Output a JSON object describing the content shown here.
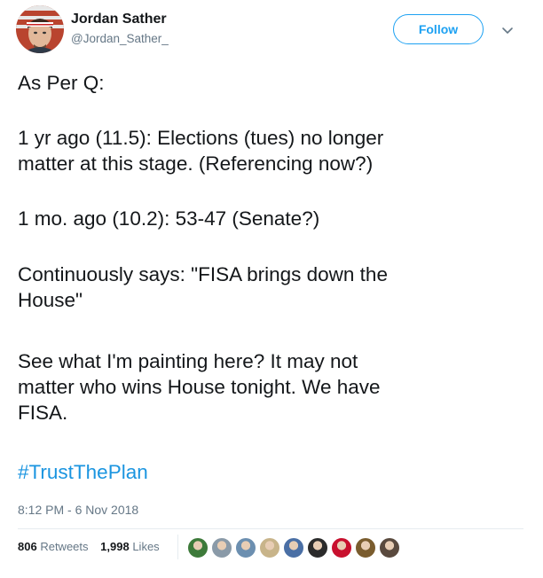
{
  "author": {
    "display_name": "Jordan Sather",
    "handle": "@Jordan_Sather_"
  },
  "follow_label": "Follow",
  "tweet": {
    "lines": [
      "As Per Q:",
      "1 yr ago (11.5): Elections (tues) no longer\nmatter at this stage. (Referencing now?)",
      "1 mo. ago (10.2): 53-47 (Senate?)",
      "Continuously says: \"FISA brings down the\nHouse\"",
      "See what I'm painting here? It may not\nmatter who wins House tonight. We have\nFISA."
    ],
    "hashtag": "#TrustThePlan",
    "timestamp": "8:12 PM - 6 Nov 2018"
  },
  "stats": {
    "retweets_count": "806",
    "retweets_label": "Retweets",
    "likes_count": "1,998",
    "likes_label": "Likes"
  },
  "liker_avatars": [
    {
      "name": "liker-avatar-1",
      "color": "#3d7a3a"
    },
    {
      "name": "liker-avatar-2",
      "color": "#8a9aa8"
    },
    {
      "name": "liker-avatar-3",
      "color": "#6c8fb0"
    },
    {
      "name": "liker-avatar-4",
      "color": "#c8b48a"
    },
    {
      "name": "liker-avatar-5",
      "color": "#4a6fa5"
    },
    {
      "name": "liker-avatar-6",
      "color": "#2b2b2b"
    },
    {
      "name": "liker-avatar-7",
      "color": "#c8102e"
    },
    {
      "name": "liker-avatar-8",
      "color": "#7a5c2e"
    },
    {
      "name": "liker-avatar-9",
      "color": "#5a4a3e"
    }
  ],
  "colors": {
    "accent": "#1da1f2",
    "hashtag": "#1b95e0",
    "secondary_text": "#657786"
  }
}
